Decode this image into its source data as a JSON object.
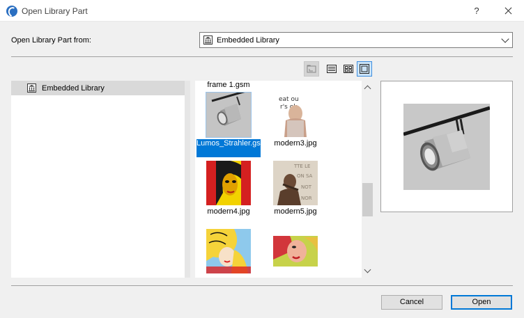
{
  "window": {
    "title": "Open Library Part",
    "help_label": "?"
  },
  "source": {
    "label": "Open Library Part from:",
    "selected": "Embedded Library"
  },
  "tree": {
    "items": [
      {
        "label": "Embedded Library"
      }
    ]
  },
  "grid": {
    "items": [
      {
        "label": "frame 1.gsm"
      },
      {
        "label": "Lumos_Strahler.gsm",
        "selected": true
      },
      {
        "label": "modern3.jpg"
      },
      {
        "label": "modern4.jpg"
      },
      {
        "label": "modern5.jpg"
      }
    ]
  },
  "buttons": {
    "cancel": "Cancel",
    "open": "Open"
  },
  "colors": {
    "selection": "#0078d7",
    "active_view": "#cce4f7"
  },
  "icons": {
    "app": "archicad-icon",
    "library": "library-icon",
    "views": [
      "folder-up-icon",
      "list-view-icon",
      "small-icons-view-icon",
      "large-preview-view-icon"
    ]
  }
}
